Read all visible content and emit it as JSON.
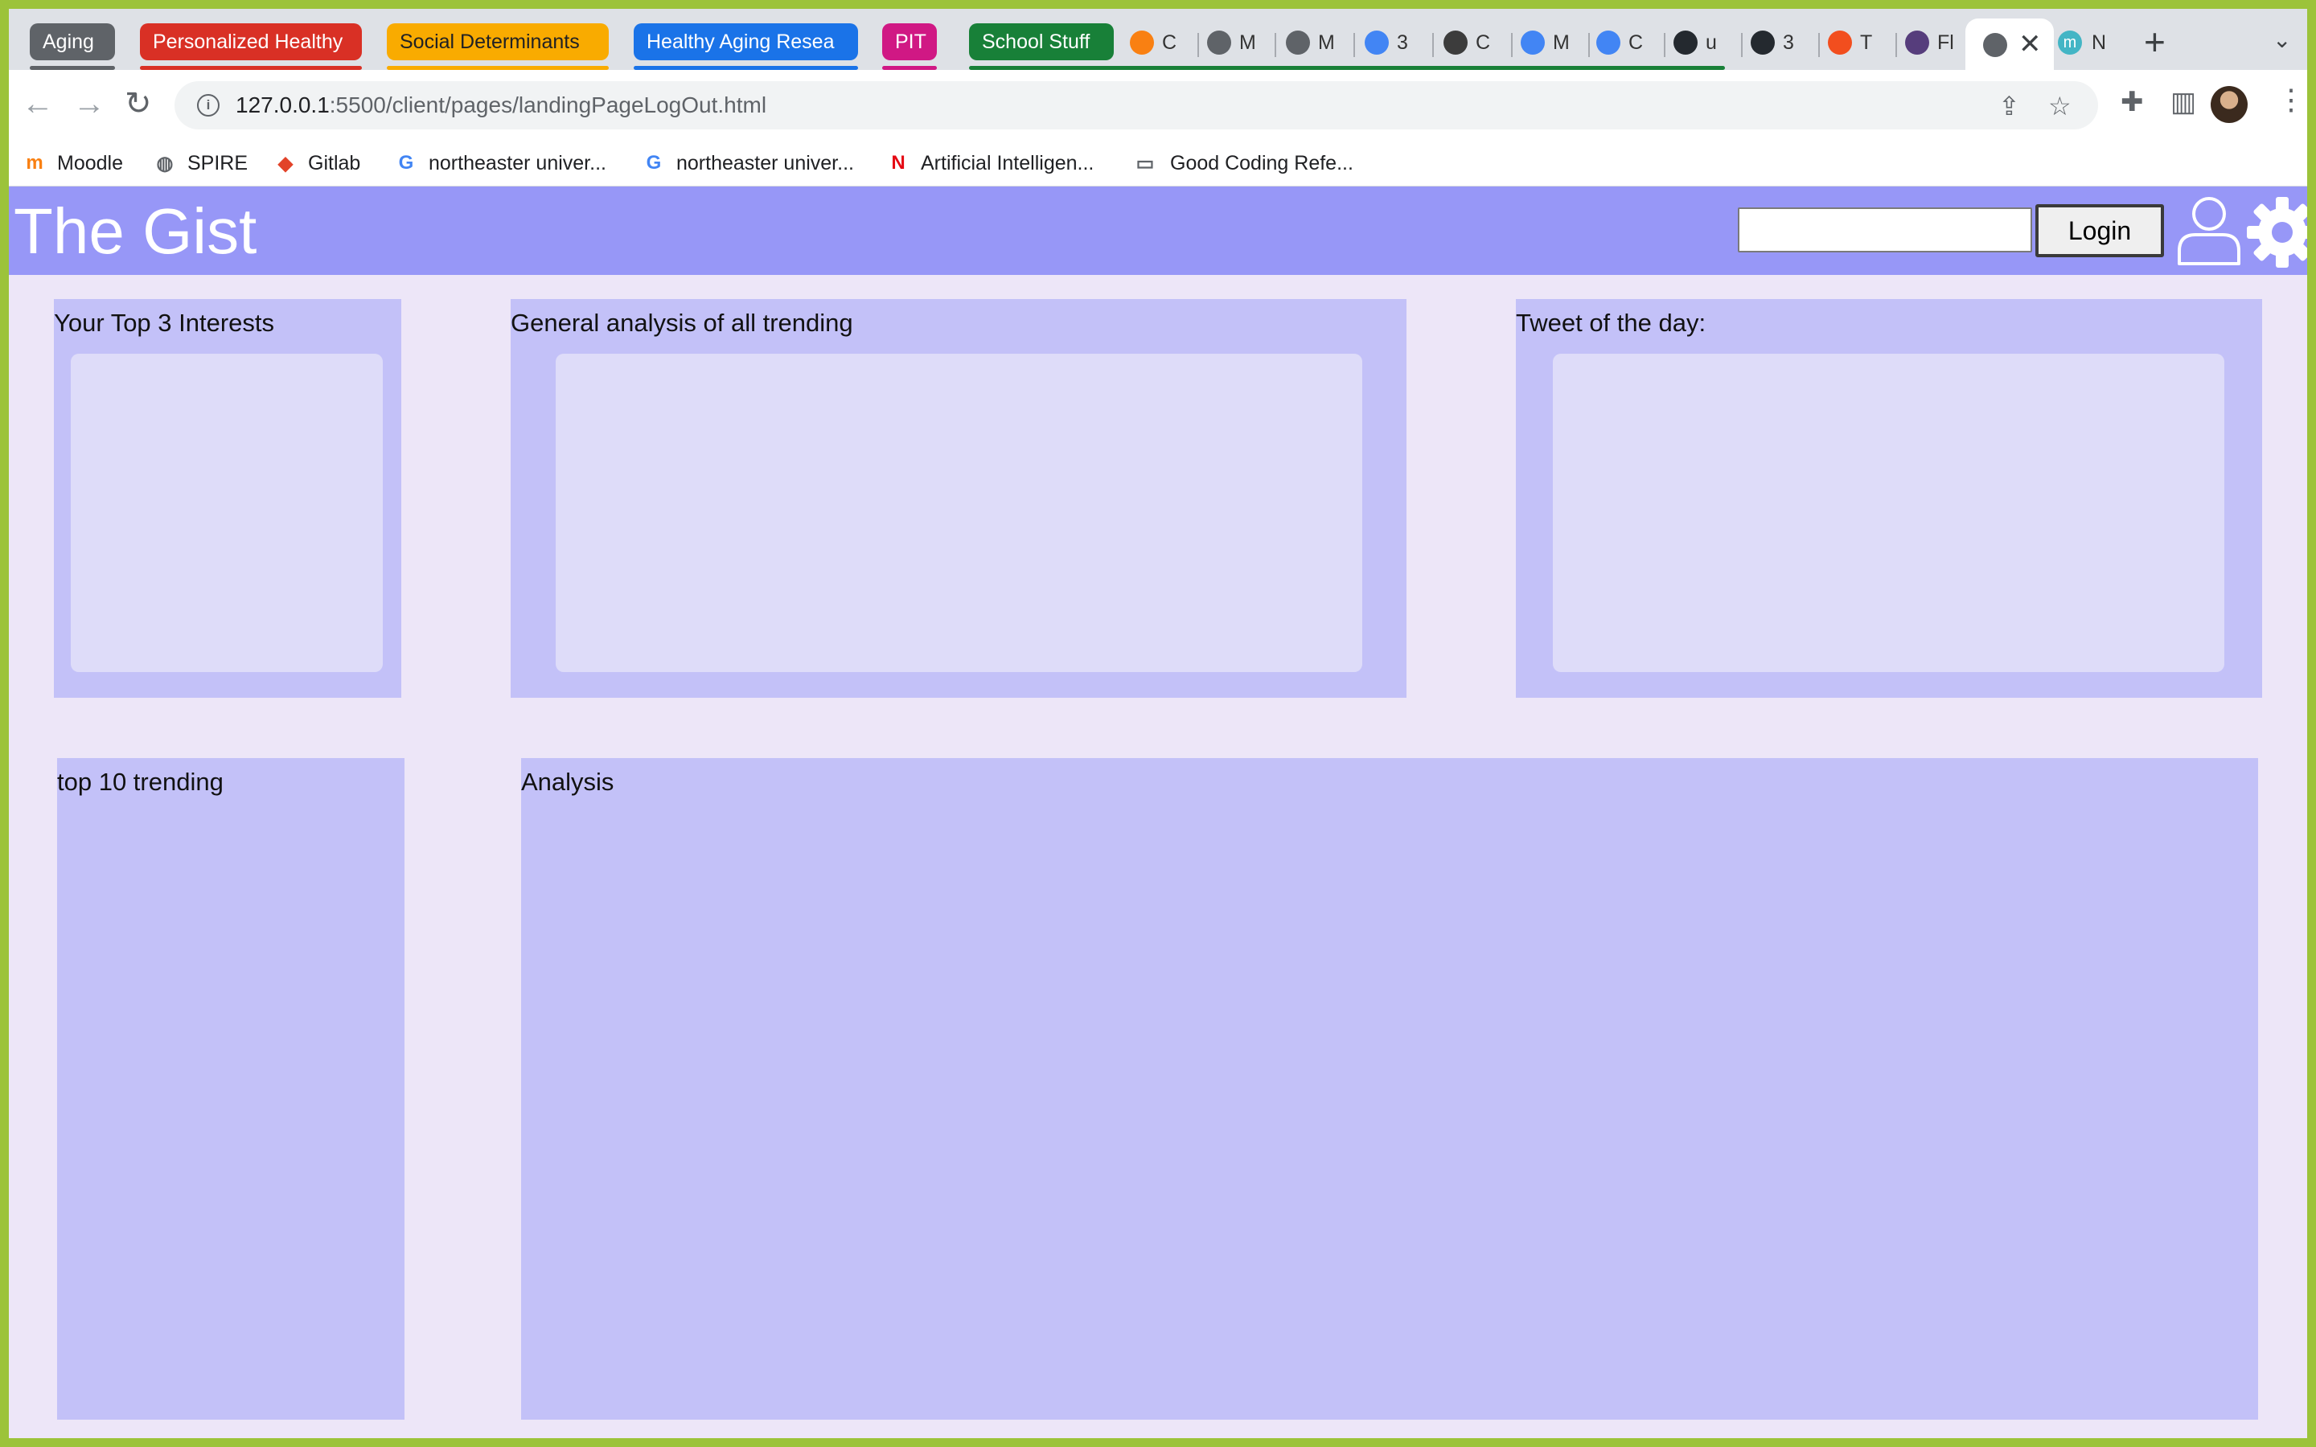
{
  "browser": {
    "tab_groups": [
      {
        "label": "Aging",
        "color": "#5f6368"
      },
      {
        "label": "Personalized Healthy",
        "color": "#d93025"
      },
      {
        "label": "Social Determinants",
        "color": "#f9ab00"
      },
      {
        "label": "Healthy Aging Resea",
        "color": "#1a73e8"
      },
      {
        "label": "PIT",
        "color": "#d01884"
      },
      {
        "label": "School Stuff",
        "color": "#188038"
      }
    ],
    "tabs": [
      {
        "label": "C",
        "icon": "moodle-icon",
        "color": "#f98012"
      },
      {
        "label": "M",
        "icon": "globe-icon",
        "color": "#5f6368"
      },
      {
        "label": "M",
        "icon": "globe-icon",
        "color": "#5f6368"
      },
      {
        "label": "3",
        "icon": "google-icon",
        "color": "#4285f4"
      },
      {
        "label": "C",
        "icon": "image-icon",
        "color": "#3c3c3c"
      },
      {
        "label": "M",
        "icon": "docs-icon",
        "color": "#4285f4"
      },
      {
        "label": "C",
        "icon": "docs-icon",
        "color": "#4285f4"
      },
      {
        "label": "u",
        "icon": "github-icon",
        "color": "#24292f"
      },
      {
        "label": "3",
        "icon": "github-icon",
        "color": "#24292f"
      },
      {
        "label": "T",
        "icon": "figma-icon",
        "color": "#f24e1e"
      },
      {
        "label": "Fl",
        "icon": "bootstrap-icon",
        "color": "#563d7c"
      }
    ],
    "active_tab_icon": "globe-icon",
    "next_tab": {
      "label": "N",
      "icon_letter": "m"
    },
    "url": {
      "host": "127.0.0.1",
      "path": ":5500/client/pages/landingPageLogOut.html"
    },
    "bookmarks": [
      {
        "label": "Moodle",
        "icon": "moodle-icon"
      },
      {
        "label": "SPIRE",
        "icon": "globe-icon"
      },
      {
        "label": "Gitlab",
        "icon": "gitlab-icon"
      },
      {
        "label": "northeaster univer...",
        "icon": "google-icon"
      },
      {
        "label": "northeaster univer...",
        "icon": "google-icon"
      },
      {
        "label": "Artificial Intelligen...",
        "icon": "netflix-icon"
      },
      {
        "label": "Good Coding Refe...",
        "icon": "folder-icon"
      }
    ]
  },
  "site": {
    "title": "The Gist",
    "search_value": "",
    "login_label": "Login",
    "accent_color": "#9797f7"
  },
  "panels": {
    "top_interests": "Your Top 3 Interests",
    "general_analysis": "General analysis of all trending",
    "tweet_of_day": "Tweet of the day:",
    "top_trending": "top 10 trending",
    "analysis": "Analysis"
  }
}
